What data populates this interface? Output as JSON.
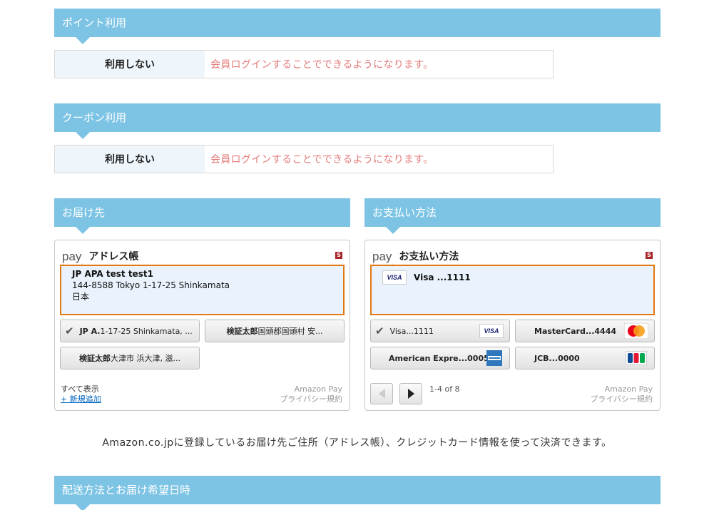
{
  "points": {
    "title": "ポイント利用",
    "option_label": "利用しない",
    "message": "会員ログインすることでできるようになります。"
  },
  "coupon": {
    "title": "クーポン利用",
    "option_label": "利用しない",
    "message": "会員ログインすることでできるようになります。"
  },
  "shipping": {
    "title": "お届け先",
    "widget": {
      "logo": "pay",
      "title": "アドレス帳",
      "badge": "S",
      "selected": {
        "name": "JP APA test test1",
        "line1": "144-8588 Tokyo 1-17-25 Shinkamata",
        "line2": "日本"
      },
      "choices": [
        {
          "bold": "JP A.",
          "rest": " 1-17-25 Shinkamata, ...",
          "checked": true
        },
        {
          "bold": "検証太郎",
          "rest": " 国頭郡国頭村 安...",
          "checked": false
        },
        {
          "bold": "検証太郎",
          "rest": " 大津市 浜大津, 滋...",
          "checked": false
        }
      ],
      "show_all": "すべて表示",
      "add_new": "+ 新規追加",
      "brand": "Amazon Pay",
      "privacy": "プライバシー規約"
    }
  },
  "payment": {
    "title": "お支払い方法",
    "widget": {
      "logo": "pay",
      "title": "お支払い方法",
      "badge": "S",
      "selected": {
        "brand_badge": "VISA",
        "label": "Visa ...1111"
      },
      "cards": [
        {
          "label": "Visa...1111",
          "badge": "VISA",
          "checked": true
        },
        {
          "label": "MasterCard...4444",
          "badge": "MC",
          "checked": false
        },
        {
          "label": "American Expre...0005",
          "badge": "AMEX",
          "checked": false
        },
        {
          "label": "JCB...0000",
          "badge": "JCB",
          "checked": false
        }
      ],
      "page_info": "1-4 of 8",
      "brand": "Amazon Pay",
      "privacy": "プライバシー規約"
    }
  },
  "note": "Amazon.co.jpに登録しているお届け先ご住所（アドレス帳）、クレジットカード情報を使って決済できます。",
  "delivery": {
    "title": "配送方法とお届け希望日時"
  },
  "colors": {
    "section_bar": "#7dc4e4",
    "selected_border": "#e47911",
    "message": "#e37a7a",
    "link": "#0066c0"
  }
}
